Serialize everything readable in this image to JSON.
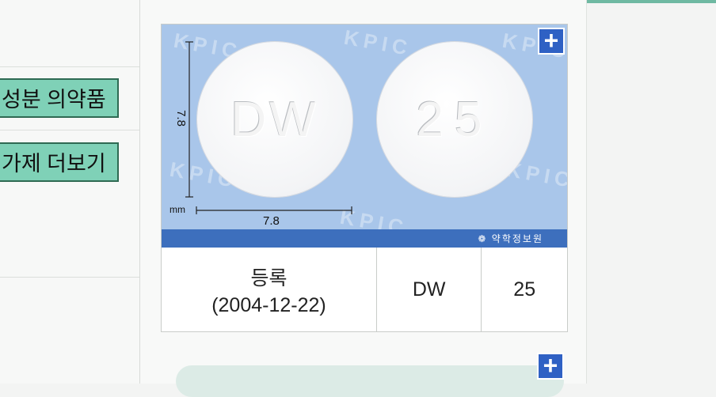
{
  "left": {
    "buttons": [
      {
        "label": "성분 의약품"
      },
      {
        "label": "가제 더보기"
      }
    ]
  },
  "pill_image": {
    "front_imprint": "DW",
    "back_imprint": "25",
    "dimension_vertical": "7.8",
    "dimension_horizontal": "7.8",
    "unit": "mm",
    "watermark": "KPIC",
    "brand": "약학정보원",
    "background_color": "#a9c6ea",
    "brand_bar_color": "#3d6fbd",
    "zoom_icon": "plus-icon"
  },
  "info": {
    "status": "등록",
    "date": "(2004-12-22)",
    "front": "DW",
    "back": "25"
  },
  "second_zoom_icon": "plus-icon"
}
